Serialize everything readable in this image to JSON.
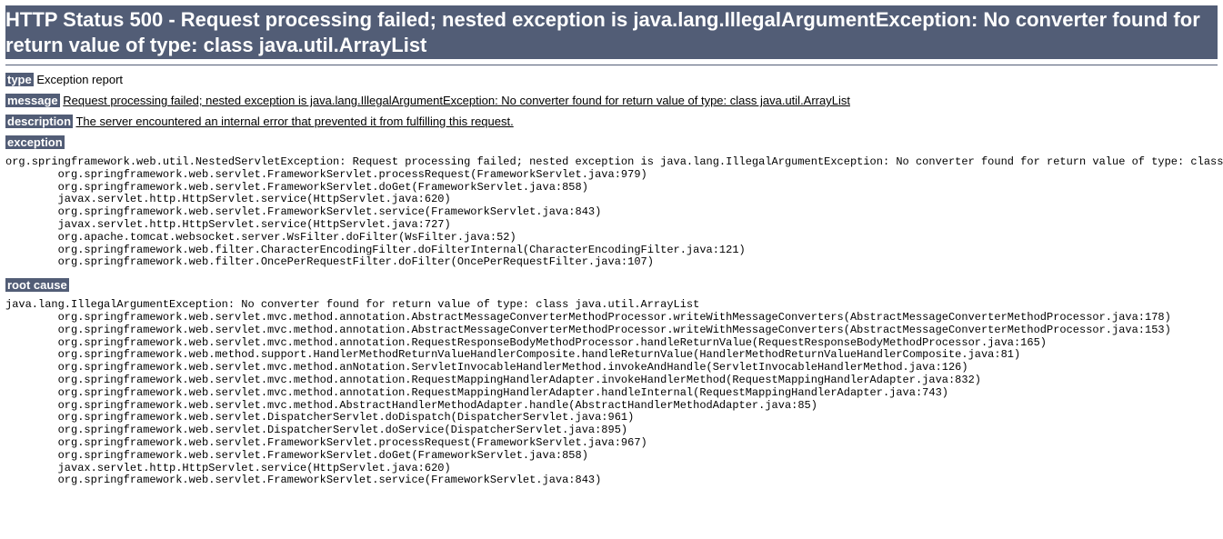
{
  "title": "HTTP Status 500 - Request processing failed; nested exception is java.lang.IllegalArgumentException: No converter found for return value of type: class java.util.ArrayList",
  "labels": {
    "type": "type",
    "message": "message",
    "description": "description",
    "exception": "exception",
    "rootcause": "root cause"
  },
  "type_value": "Exception report",
  "message_value": "Request processing failed; nested exception is java.lang.IllegalArgumentException: No converter found for return value of type: class java.util.ArrayList",
  "description_value": "The server encountered an internal error that prevented it from fulfilling this request.",
  "exception_header": "org.springframework.web.util.NestedServletException: Request processing failed; nested exception is java.lang.IllegalArgumentException: No converter found for return value of type: class java.util.ArrayList",
  "exception_lines": [
    "org.springframework.web.servlet.FrameworkServlet.processRequest(FrameworkServlet.java:979)",
    "org.springframework.web.servlet.FrameworkServlet.doGet(FrameworkServlet.java:858)",
    "javax.servlet.http.HttpServlet.service(HttpServlet.java:620)",
    "org.springframework.web.servlet.FrameworkServlet.service(FrameworkServlet.java:843)",
    "javax.servlet.http.HttpServlet.service(HttpServlet.java:727)",
    "org.apache.tomcat.websocket.server.WsFilter.doFilter(WsFilter.java:52)",
    "org.springframework.web.filter.CharacterEncodingFilter.doFilterInternal(CharacterEncodingFilter.java:121)",
    "org.springframework.web.filter.OncePerRequestFilter.doFilter(OncePerRequestFilter.java:107)"
  ],
  "rootcause_header": "java.lang.IllegalArgumentException: No converter found for return value of type: class java.util.ArrayList",
  "rootcause_lines": [
    "org.springframework.web.servlet.mvc.method.annotation.AbstractMessageConverterMethodProcessor.writeWithMessageConverters(AbstractMessageConverterMethodProcessor.java:178)",
    "org.springframework.web.servlet.mvc.method.annotation.AbstractMessageConverterMethodProcessor.writeWithMessageConverters(AbstractMessageConverterMethodProcessor.java:153)",
    "org.springframework.web.servlet.mvc.method.annotation.RequestResponseBodyMethodProcessor.handleReturnValue(RequestResponseBodyMethodProcessor.java:165)",
    "org.springframework.web.method.support.HandlerMethodReturnValueHandlerComposite.handleReturnValue(HandlerMethodReturnValueHandlerComposite.java:81)",
    "org.springframework.web.servlet.mvc.method.anNotation.ServletInvocableHandlerMethod.invokeAndHandle(ServletInvocableHandlerMethod.java:126)",
    "org.springframework.web.servlet.mvc.method.annotation.RequestMappingHandlerAdapter.invokeHandlerMethod(RequestMappingHandlerAdapter.java:832)",
    "org.springframework.web.servlet.mvc.method.annotation.RequestMappingHandlerAdapter.handleInternal(RequestMappingHandlerAdapter.java:743)",
    "org.springframework.web.servlet.mvc.method.AbstractHandlerMethodAdapter.handle(AbstractHandlerMethodAdapter.java:85)",
    "org.springframework.web.servlet.DispatcherServlet.doDispatch(DispatcherServlet.java:961)",
    "org.springframework.web.servlet.DispatcherServlet.doService(DispatcherServlet.java:895)",
    "org.springframework.web.servlet.FrameworkServlet.processRequest(FrameworkServlet.java:967)",
    "org.springframework.web.servlet.FrameworkServlet.doGet(FrameworkServlet.java:858)",
    "javax.servlet.http.HttpServlet.service(HttpServlet.java:620)",
    "org.springframework.web.servlet.FrameworkServlet.service(FrameworkServlet.java:843)"
  ]
}
